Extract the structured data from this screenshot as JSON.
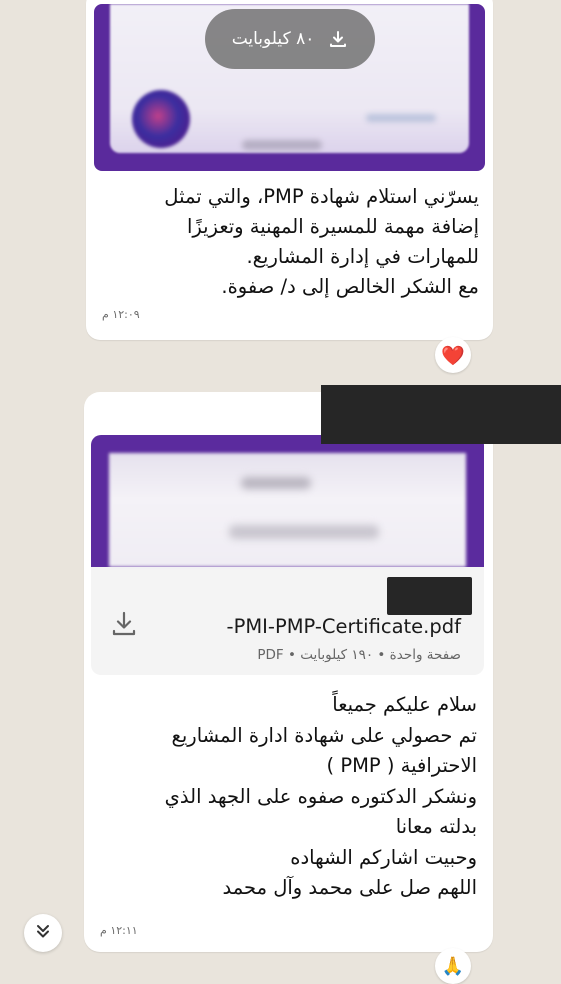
{
  "message1": {
    "download_size": "٨٠ كيلوبايت",
    "lines": [
      "يسرّني استلام شهادة PMP، والتي تمثل",
      "إضافة مهمة للمسيرة المهنية وتعزيزًا",
      "للمهارات في إدارة المشاريع.",
      "مع الشكر الخالص إلى د/ صفوة."
    ],
    "time": "١٢:٠٩ م",
    "reaction": "❤️"
  },
  "message2": {
    "document": {
      "name": "-PMI-PMP-Certificate.pdf",
      "meta": "صفحة واحدة • ١٩٠ كيلوبايت • PDF"
    },
    "lines": [
      "سلام عليكم جميعاً",
      "تم حصولي على شهادة ادارة المشاريع",
      "الاحترافية ( PMP )",
      "ونشكر الدكتوره صفوه على الجهد الذي",
      "بدلته معانا",
      "وحبيت اشاركم الشهاده",
      "اللهم صل على محمد وآل محمد"
    ],
    "time": "١٢:١١ م",
    "reaction": "🙏"
  },
  "icons": {
    "download": "download-icon",
    "scroll": "double-chevron-down-icon"
  },
  "colors": {
    "chat_background": "#e9e4dc",
    "bubble": "#ffffff",
    "certificate_purple": "#5b2b9e",
    "heart": "#e0202c"
  }
}
